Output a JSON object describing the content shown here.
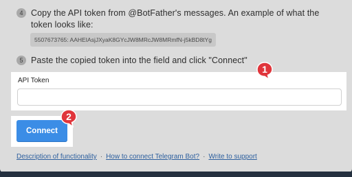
{
  "steps": [
    {
      "number": "4",
      "text": "Copy the API token from @BotFather's messages. An example of what the token looks like:"
    },
    {
      "number": "5",
      "text": "Paste the copied token into the field and click \"Connect\""
    }
  ],
  "token_example": "5507673765: AAHEIAsjJXyaK8GYcJW8MRcJW8MRmfN-j5kBD8tYg",
  "api_token": {
    "label": "API Token",
    "value": "",
    "placeholder": ""
  },
  "connect_button": {
    "label": "Connect"
  },
  "markers": [
    {
      "label": "1"
    },
    {
      "label": "2"
    }
  ],
  "footer": {
    "links": [
      "Description of functionality",
      "How to connect Telegram Bot?",
      "Write to support"
    ],
    "separator": "·"
  },
  "colors": {
    "accent": "#3b8de6",
    "marker": "#e0353b",
    "link": "#2d5f9e"
  }
}
